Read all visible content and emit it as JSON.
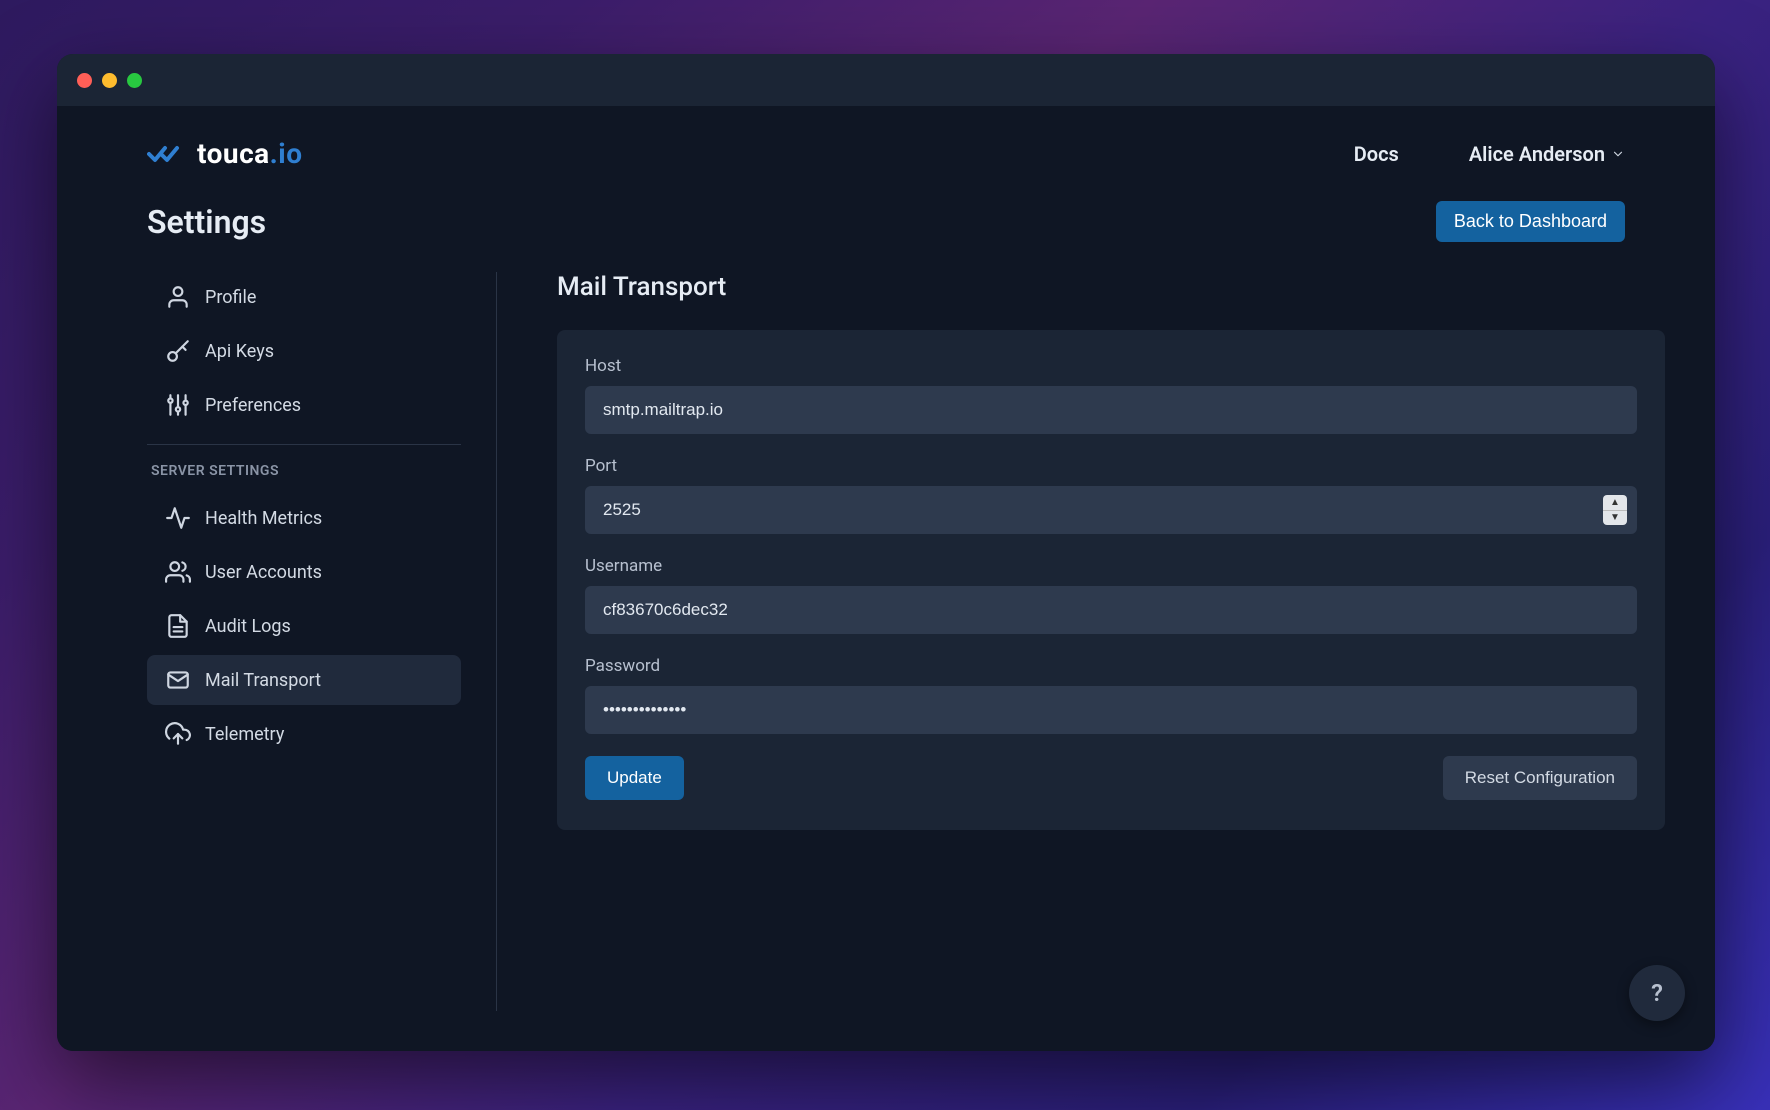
{
  "brand": {
    "name": "touca",
    "suffix": ".io"
  },
  "nav": {
    "docs": "Docs",
    "user_name": "Alice Anderson"
  },
  "page": {
    "title": "Settings",
    "back_button": "Back to Dashboard"
  },
  "sidebar": {
    "items_user": [
      {
        "label": "Profile",
        "icon": "user"
      },
      {
        "label": "Api Keys",
        "icon": "key"
      },
      {
        "label": "Preferences",
        "icon": "sliders"
      }
    ],
    "section_label": "SERVER SETTINGS",
    "items_server": [
      {
        "label": "Health Metrics",
        "icon": "activity"
      },
      {
        "label": "User Accounts",
        "icon": "users"
      },
      {
        "label": "Audit Logs",
        "icon": "file"
      },
      {
        "label": "Mail Transport",
        "icon": "mail",
        "active": true
      },
      {
        "label": "Telemetry",
        "icon": "upload-cloud"
      }
    ]
  },
  "content": {
    "title": "Mail Transport",
    "fields": {
      "host": {
        "label": "Host",
        "value": "smtp.mailtrap.io"
      },
      "port": {
        "label": "Port",
        "value": "2525"
      },
      "username": {
        "label": "Username",
        "value": "cf83670c6dec32"
      },
      "password": {
        "label": "Password",
        "value": "••••••••••••••"
      }
    },
    "actions": {
      "update": "Update",
      "reset": "Reset Configuration"
    }
  },
  "help_fab": "?"
}
